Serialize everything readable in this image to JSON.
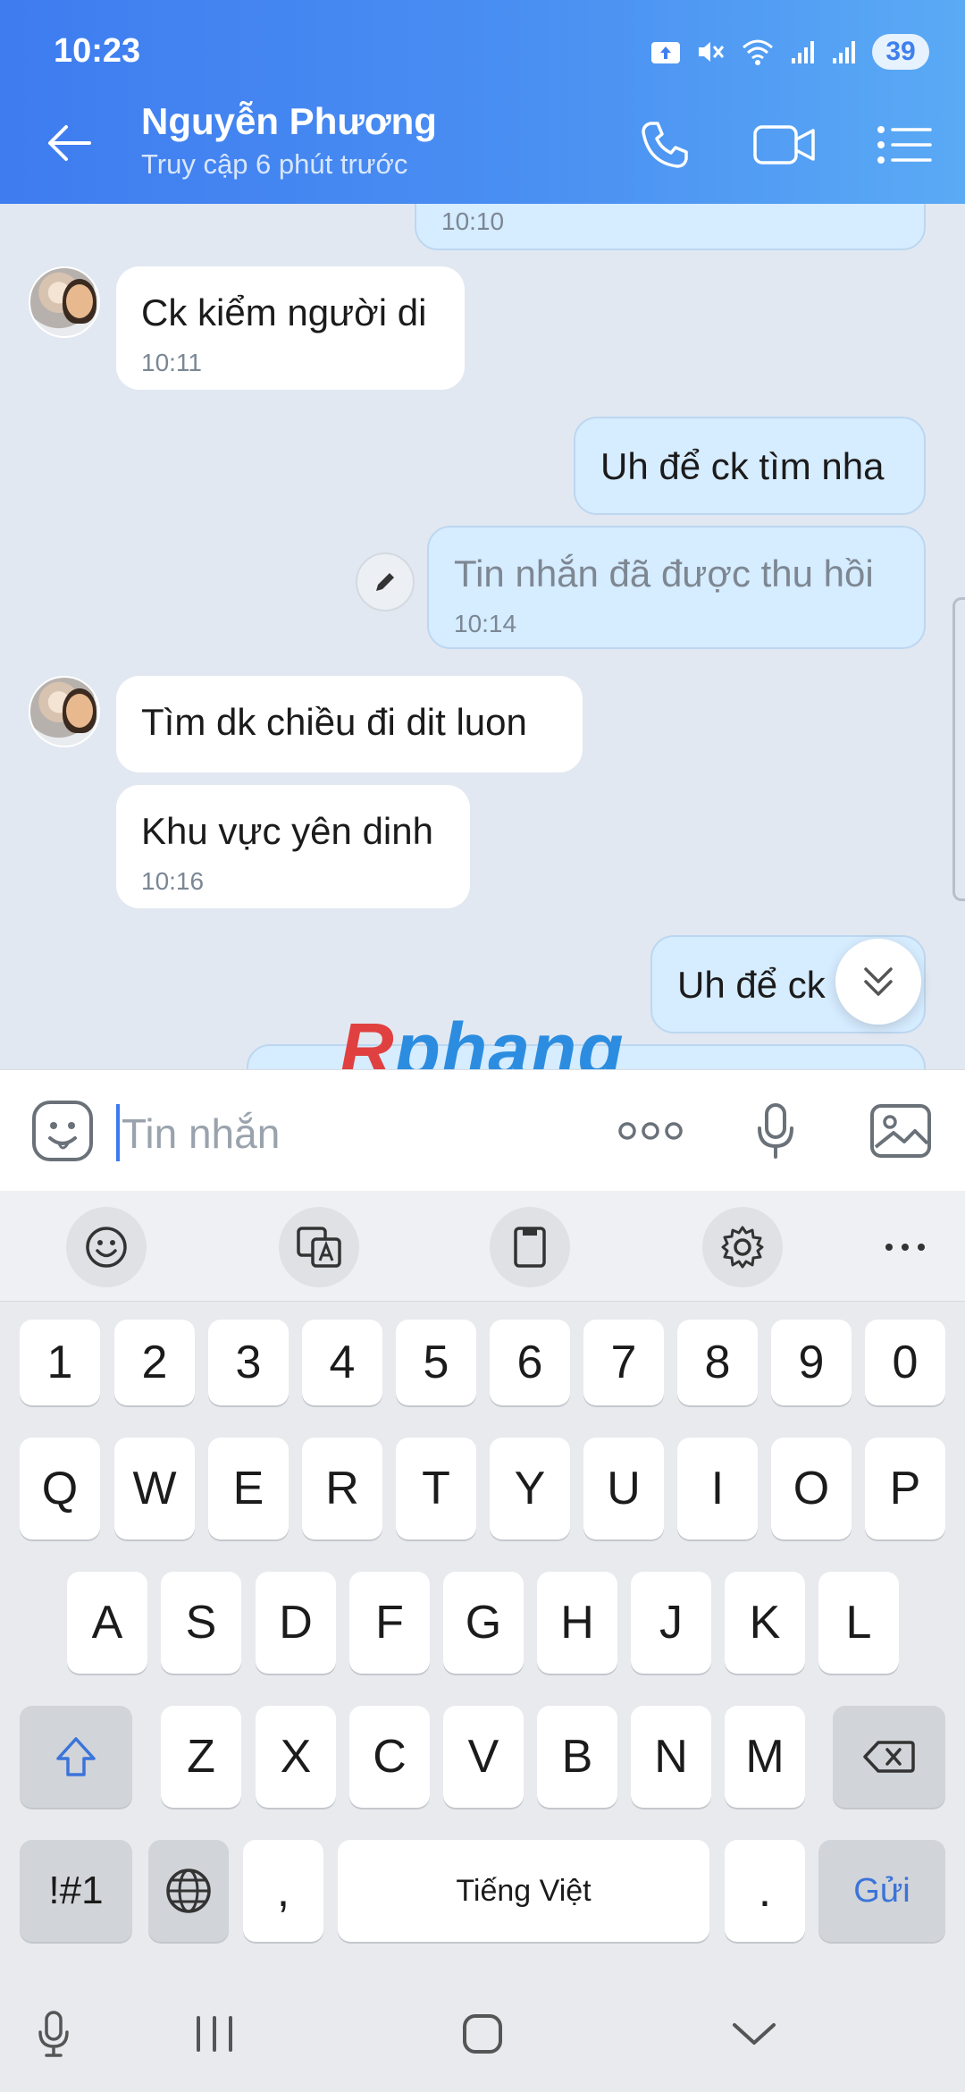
{
  "status_bar": {
    "time": "10:23",
    "battery": "39"
  },
  "header": {
    "contact_name": "Nguyễn Phương",
    "subtitle": "Truy cập 6 phút trước"
  },
  "messages": [
    {
      "dir": "out",
      "text": "",
      "time": "10:10"
    },
    {
      "dir": "in",
      "text": "Ck kiểm người di",
      "time": "10:11"
    },
    {
      "dir": "out",
      "text": "Uh để ck tìm nha",
      "time": ""
    },
    {
      "dir": "out",
      "text": "Tin nhắn đã được thu hồi",
      "time": "10:14",
      "recalled": true
    },
    {
      "dir": "in",
      "text": "Tìm dk chiều đi dit luon",
      "time": ""
    },
    {
      "dir": "in",
      "text": "Khu vực yên dinh",
      "time": "10:16"
    },
    {
      "dir": "out",
      "text": "Uh để ck",
      "time": ""
    }
  ],
  "watermark": {
    "part_a": "R",
    "part_b": "phang"
  },
  "input": {
    "placeholder": "Tin nhắn"
  },
  "keyboard": {
    "row_numbers": [
      "1",
      "2",
      "3",
      "4",
      "5",
      "6",
      "7",
      "8",
      "9",
      "0"
    ],
    "row_1": [
      "Q",
      "W",
      "E",
      "R",
      "T",
      "Y",
      "U",
      "I",
      "O",
      "P"
    ],
    "row_2": [
      "A",
      "S",
      "D",
      "F",
      "G",
      "H",
      "J",
      "K",
      "L"
    ],
    "row_3": [
      "Z",
      "X",
      "C",
      "V",
      "B",
      "N",
      "M"
    ],
    "symbols_key": "!#1",
    "comma_key": ",",
    "space_label": "Tiếng Việt",
    "period_key": ".",
    "send_label": "Gửi"
  },
  "icons": [
    "back-arrow-icon",
    "phone-icon",
    "video-icon",
    "menu-icon",
    "sticker-icon",
    "more-icon",
    "mic-icon",
    "image-icon",
    "emoji-icon",
    "translate-icon",
    "clipboard-icon",
    "settings-icon",
    "shift-icon",
    "backspace-icon",
    "globe-icon",
    "edit-icon",
    "chevron-double-down-icon"
  ],
  "colors": {
    "header_start": "#3e7cf0",
    "header_end": "#5aaaf5",
    "outgoing_bubble": "#d6ecff",
    "incoming_bubble": "#ffffff",
    "chat_bg": "#e2e8f1",
    "send_text": "#3b74d9"
  }
}
